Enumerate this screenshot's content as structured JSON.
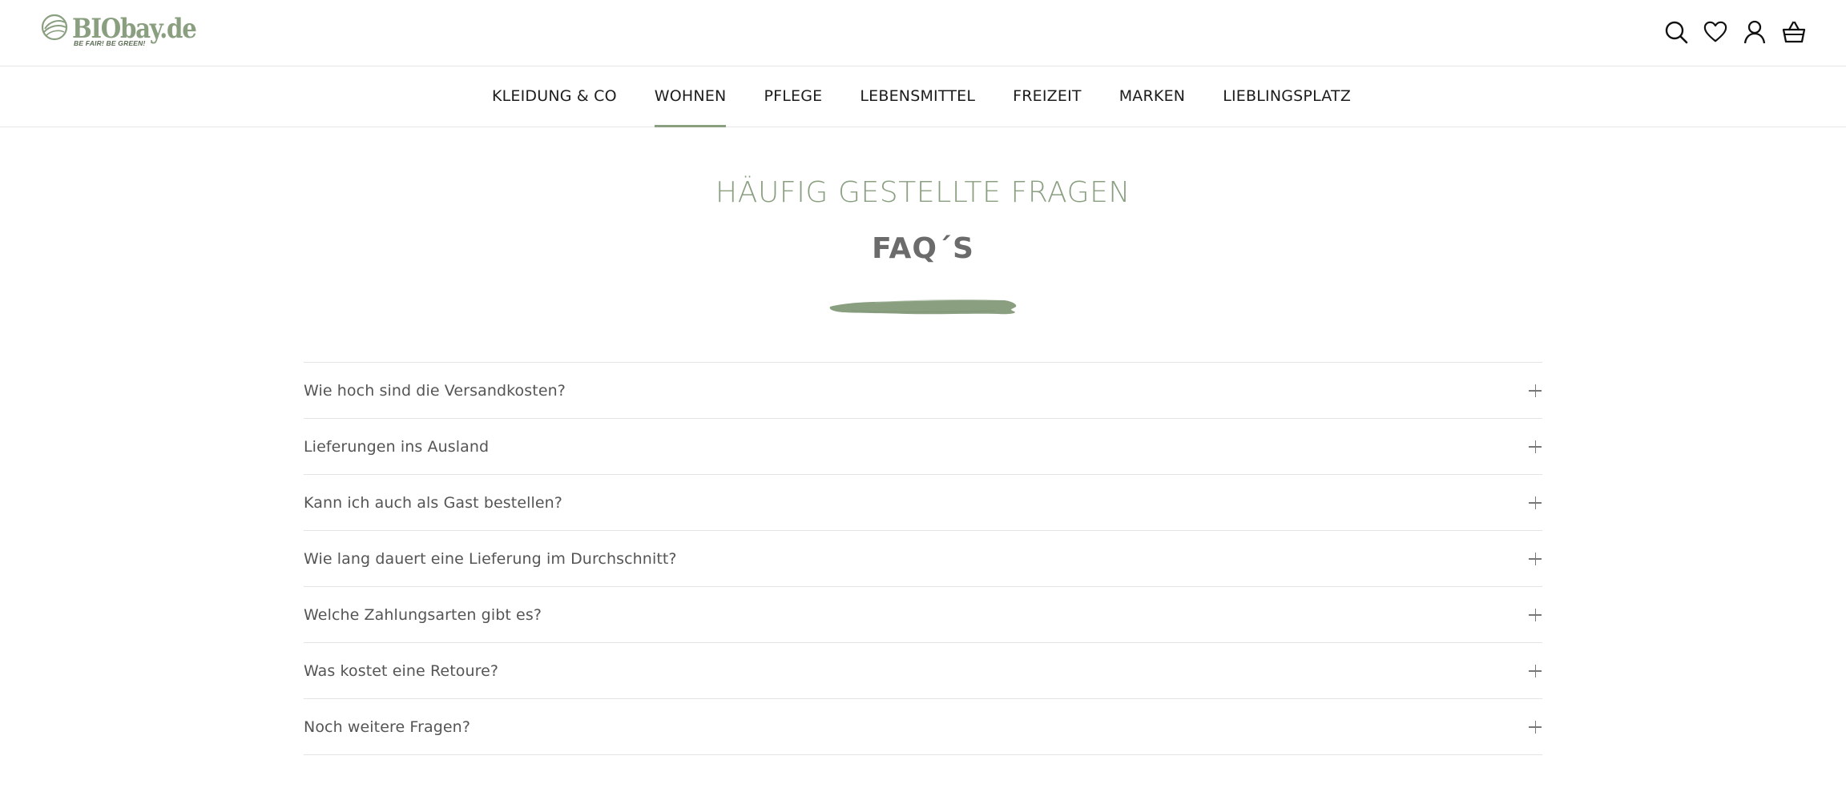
{
  "header": {
    "logo": {
      "icon": "leaf-logo-icon",
      "wordmark": "BIObay.de",
      "tagline": "BE FAIR! BE GREEN!"
    },
    "icons": [
      "search-icon",
      "heart-icon",
      "account-icon",
      "basket-icon"
    ]
  },
  "nav": {
    "items": [
      {
        "label": "KLEIDUNG & CO"
      },
      {
        "label": "WOHNEN"
      },
      {
        "label": "PFLEGE"
      },
      {
        "label": "LEBENSMITTEL"
      },
      {
        "label": "FREIZEIT"
      },
      {
        "label": "MARKEN"
      },
      {
        "label": "LIEBLINGSPLATZ"
      }
    ],
    "active": "WOHNEN"
  },
  "main": {
    "subtitle": "HÄUFIG GESTELLTE FRAGEN",
    "title": "FAQ´S",
    "faqs": [
      {
        "question": "Wie hoch sind die Versandkosten?"
      },
      {
        "question": "Lieferungen ins Ausland"
      },
      {
        "question": "Kann ich auch als Gast bestellen?"
      },
      {
        "question": "Wie lang dauert eine Lieferung im Durchschnitt?"
      },
      {
        "question": "Welche Zahlungsarten gibt es?"
      },
      {
        "question": "Was kostet eine Retoure?"
      },
      {
        "question": "Noch weitere Fragen?"
      }
    ]
  },
  "colors": {
    "accent_green": "#8a9f80",
    "title_gray": "#6b6b6b",
    "text_gray": "#555555"
  }
}
